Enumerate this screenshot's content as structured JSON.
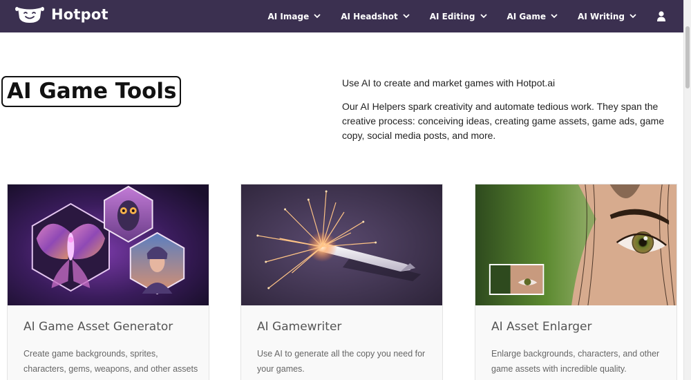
{
  "brand": {
    "name": "Hotpot"
  },
  "nav": {
    "items": [
      {
        "label": "AI Image"
      },
      {
        "label": "AI Headshot"
      },
      {
        "label": "AI Editing"
      },
      {
        "label": "AI Game"
      },
      {
        "label": "AI Writing"
      }
    ]
  },
  "hero": {
    "title": "AI Game Tools",
    "intro": "Use AI to create and market games with Hotpot.ai",
    "description": "Our AI Helpers spark creativity and automate tedious work. They span the creative process: conceiving ideas, creating game assets, game ads, game copy, social media posts, and more."
  },
  "cards": [
    {
      "title": "AI Game Asset Generator",
      "description": "Create game backgrounds, sprites, characters, gems, weapons, and other assets"
    },
    {
      "title": "AI Gamewriter",
      "description": "Use AI to generate all the copy you need for your games."
    },
    {
      "title": "AI Asset Enlarger",
      "description": "Enlarge backgrounds, characters, and other game assets with incredible quality."
    }
  ],
  "colors": {
    "navbar": "#3b3050",
    "card_background": "#f9f9f9",
    "card_title": "#555555",
    "card_text": "#666666"
  },
  "icons": {
    "logo": "smiling-pot-icon",
    "dropdown": "chevron-down-icon",
    "user": "user-icon"
  }
}
